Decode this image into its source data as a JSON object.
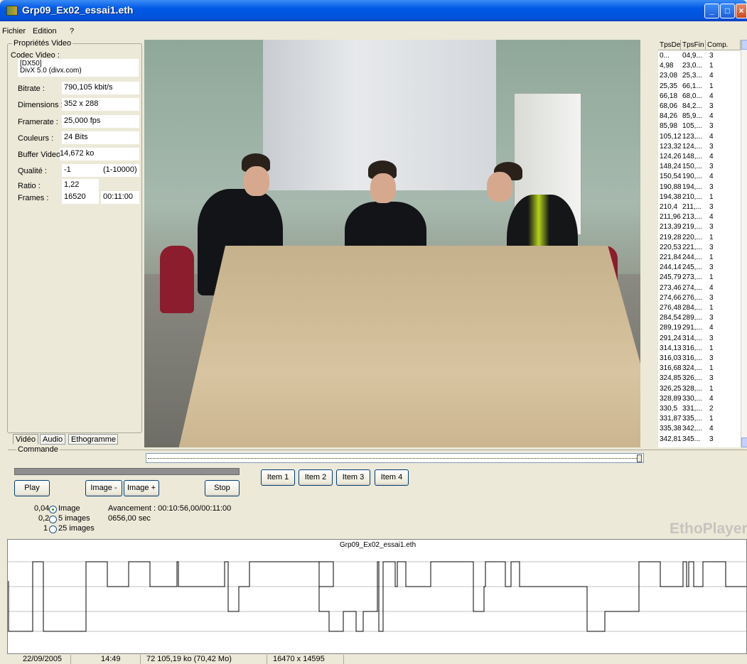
{
  "window": {
    "title": "Grp09_Ex02_essai1.eth"
  },
  "menu": [
    "Fichier",
    "Edition",
    "?"
  ],
  "props": {
    "legend": "Propriétés Video",
    "codec_label": "Codec Video :",
    "codec_value_1": "[DX50]",
    "codec_value_2": "DivX 5.0 (divx.com)",
    "bitrate_label": "Bitrate :",
    "bitrate": "790,105 kbit/s",
    "dimensions_label": "Dimensions :",
    "dimensions": "352 x 288",
    "framerate_label": "Framerate :",
    "framerate": "25,000 fps",
    "couleurs_label": "Couleurs :",
    "couleurs": "24 Bits",
    "buffer_label": "Buffer Video :",
    "buffer": "14,672 ko",
    "qualite_label": "Qualité :",
    "qualite": "-1",
    "qualite_range": "(1-10000)",
    "ratio_label": "Ratio :",
    "ratio": "1,22",
    "frames_label": "Frames :",
    "frames": "16520",
    "duration": "00:11:00"
  },
  "tabs": [
    "Vidéo",
    "Audio",
    "Ethogramme"
  ],
  "list": {
    "headers": [
      "TpsDep.",
      "TpsFin",
      "Comp."
    ],
    "rows": [
      [
        "0...",
        "04,9...",
        "3"
      ],
      [
        "4,98",
        "23,0...",
        "1"
      ],
      [
        "23,08",
        "25,3...",
        "4"
      ],
      [
        "25,35",
        "66,1...",
        "1"
      ],
      [
        "66,18",
        "68,0...",
        "4"
      ],
      [
        "68,06",
        "84,2...",
        "3"
      ],
      [
        "84,26",
        "85,9...",
        "4"
      ],
      [
        "85,98",
        "105,...",
        "3"
      ],
      [
        "105,12",
        "123,...",
        "4"
      ],
      [
        "123,32",
        "124,...",
        "3"
      ],
      [
        "124,26",
        "148,...",
        "4"
      ],
      [
        "148,24",
        "150,...",
        "3"
      ],
      [
        "150,54",
        "190,...",
        "4"
      ],
      [
        "190,88",
        "194,...",
        "3"
      ],
      [
        "194,38",
        "210,...",
        "1"
      ],
      [
        "210,4",
        "211,...",
        "3"
      ],
      [
        "211,96",
        "213,...",
        "4"
      ],
      [
        "213,39",
        "219,...",
        "3"
      ],
      [
        "219,28",
        "220,...",
        "1"
      ],
      [
        "220,53",
        "221,...",
        "3"
      ],
      [
        "221,84",
        "244,...",
        "1"
      ],
      [
        "244,14",
        "245,...",
        "3"
      ],
      [
        "245,79",
        "273,...",
        "1"
      ],
      [
        "273,46",
        "274,...",
        "4"
      ],
      [
        "274,66",
        "276,...",
        "3"
      ],
      [
        "276,48",
        "284,...",
        "1"
      ],
      [
        "284,54",
        "289,...",
        "3"
      ],
      [
        "289,19",
        "291,...",
        "4"
      ],
      [
        "291,24",
        "314,...",
        "3"
      ],
      [
        "314,13",
        "316,...",
        "1"
      ],
      [
        "316,03",
        "316,...",
        "3"
      ],
      [
        "316,68",
        "324,...",
        "1"
      ],
      [
        "324,85",
        "326,...",
        "3"
      ],
      [
        "326,25",
        "328,...",
        "1"
      ],
      [
        "328,89",
        "330,...",
        "4"
      ],
      [
        "330,5",
        "331,...",
        "2"
      ],
      [
        "331,87",
        "335,...",
        "1"
      ],
      [
        "335,38",
        "342,...",
        "4"
      ],
      [
        "342,81",
        "345...",
        "3"
      ]
    ]
  },
  "commande": {
    "legend": "Commande",
    "play": "Play",
    "image_minus": "Image -",
    "image_plus": "Image +",
    "stop": "Stop",
    "items": [
      "Item 1",
      "Item 2",
      "Item 3",
      "Item 4"
    ],
    "step_values": [
      "0,04",
      "0,2",
      "1"
    ],
    "step_labels": [
      "Image",
      "5 images",
      "25 images"
    ],
    "selected_step": 0,
    "avancement": "Avancement : 00:10:56,00/00:11:00",
    "seconds": "0656,00 sec",
    "progress": 0.994
  },
  "brand": "EthoPlayer",
  "ethogram": {
    "title": "Grp09_Ex02_essai1.eth"
  },
  "status": [
    "22/09/2005",
    "14:49",
    "72 105,19 ko (70,42 Mo)",
    "16470 x 14595"
  ]
}
